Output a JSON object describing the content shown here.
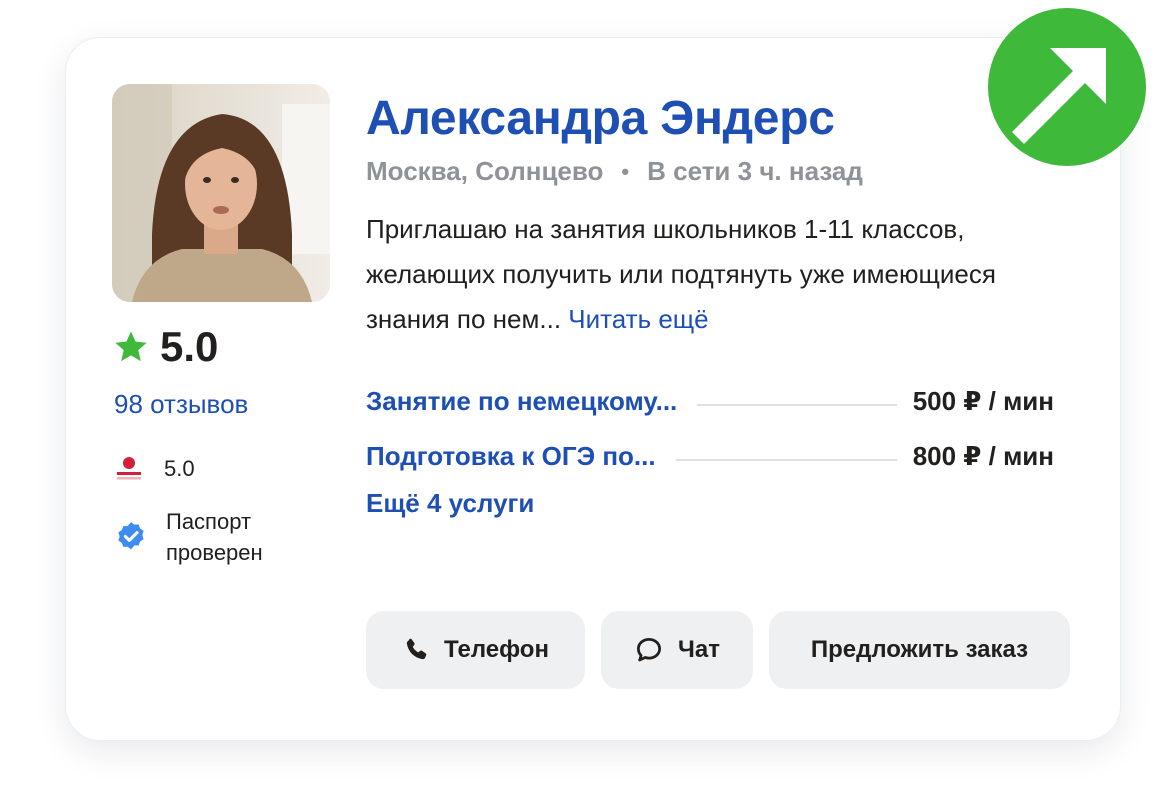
{
  "profile": {
    "name": "Александра Эндерс",
    "location": "Москва, Солнцево",
    "separator": "•",
    "online_status": "В сети 3 ч. назад",
    "description": "Приглашаю на занятия школьников 1-11 классов, желающих получить или подтянуть уже имеющиеся знания по нем...",
    "read_more_label": "Читать ещё"
  },
  "rating": {
    "value": "5.0",
    "reviews_label": "98 отзывов",
    "star_color": "#3fb93a"
  },
  "metric": {
    "value": "5.0",
    "icon": "user-rating-icon"
  },
  "verification": {
    "label": "Паспорт проверен",
    "icon": "verified-badge-icon",
    "color": "#3d8cf0"
  },
  "services": [
    {
      "name": "Занятие по немецкому...",
      "price": "500 ₽ / мин"
    },
    {
      "name": "Подготовка к ОГЭ по...",
      "price": "800 ₽ / мин"
    }
  ],
  "more_services_label": "Ещё 4 услуги",
  "actions": {
    "phone_label": "Телефон",
    "chat_label": "Чат",
    "order_label": "Предложить заказ"
  },
  "colors": {
    "accent_blue": "#1d4fb5",
    "badge_green": "#3fb93a",
    "button_bg": "#eff0f2"
  }
}
